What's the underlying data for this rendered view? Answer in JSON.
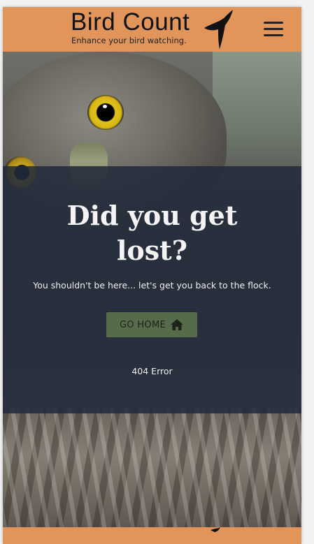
{
  "header": {
    "title": "Bird Count",
    "tagline": "Enhance your bird watching.",
    "logo_icon": "swallow-bird-icon",
    "menu_icon": "hamburger-menu-icon"
  },
  "main": {
    "headline": "Did you get lost?",
    "message": "You shouldn't be here... let's get you back to the flock.",
    "button_label": "GO HOME",
    "button_icon": "home-icon",
    "error_text": "404 Error"
  },
  "colors": {
    "accent": "#e1955a",
    "overlay": "#222a3a",
    "button": "#556b4a"
  }
}
